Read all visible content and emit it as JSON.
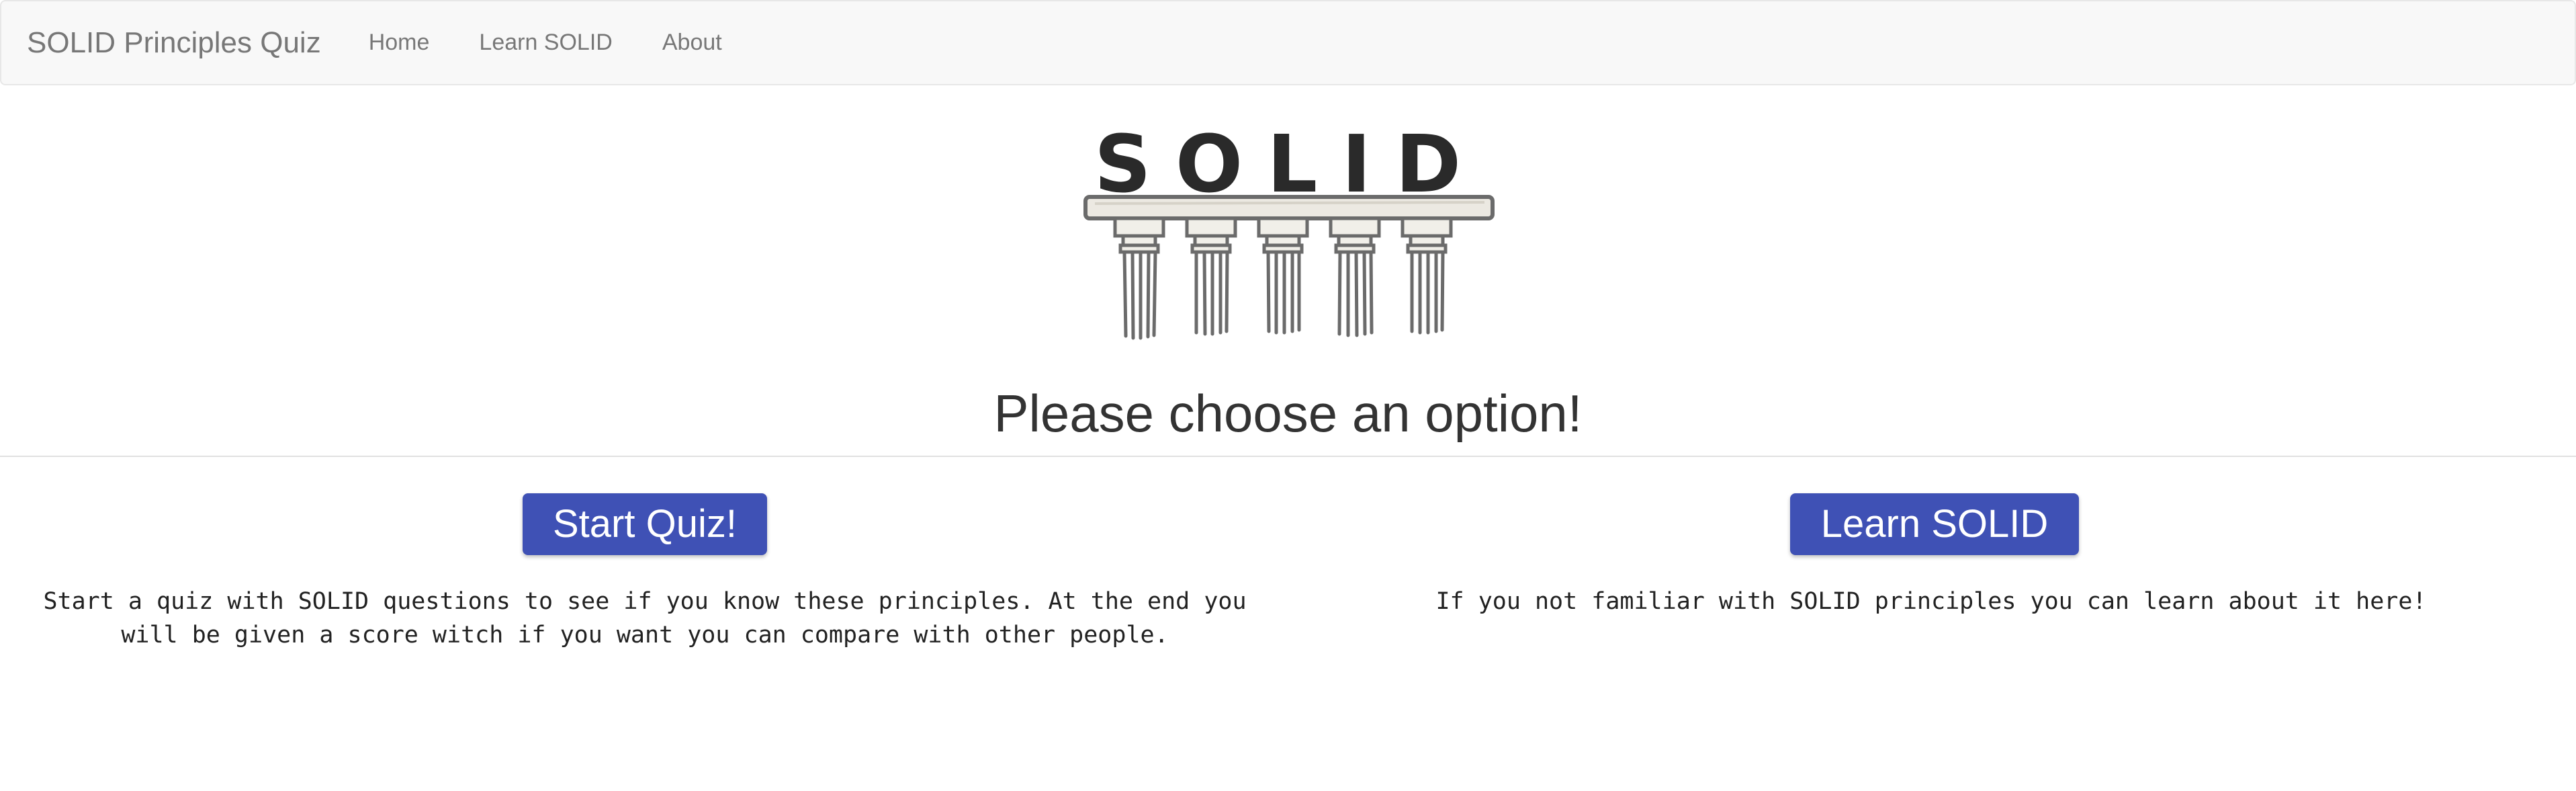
{
  "navbar": {
    "brand": "SOLID Principles Quiz",
    "links": [
      "Home",
      "Learn SOLID",
      "About"
    ]
  },
  "hero": {
    "logo_text": "SOLID",
    "headline": "Please choose an option!"
  },
  "options": {
    "quiz": {
      "button_label": "Start Quiz!",
      "description": "Start a quiz with SOLID questions to see if you know these principles. At the end you will be given a score witch if you want you can compare with other people."
    },
    "learn": {
      "button_label": "Learn SOLID",
      "description": "If you not familiar with SOLID principles you can learn about it here!"
    }
  },
  "colors": {
    "navbar_bg": "#f8f8f8",
    "nav_text": "#777777",
    "button_bg": "#3f51b5",
    "button_text": "#ffffff"
  }
}
